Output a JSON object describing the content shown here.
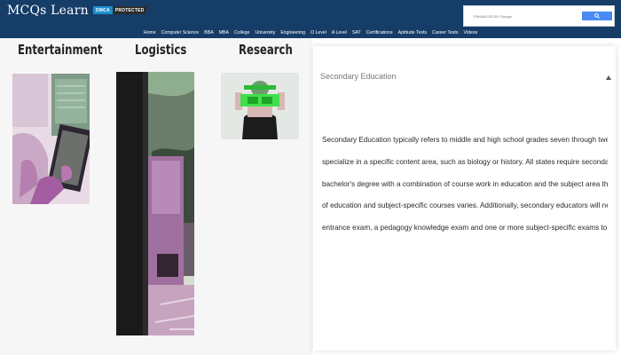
{
  "header": {
    "logo_text": "MCQs Learn",
    "badge_dmca": "DMCA",
    "badge_protected": "PROTECTED",
    "search_placeholder": "ENHANCED BY Google",
    "search_button_icon": "search-icon"
  },
  "nav": {
    "items": [
      "Home",
      "Computer Science",
      "BBA",
      "MBA",
      "College",
      "University",
      "Engineering",
      "O Level",
      "A Level",
      "SAT",
      "Certifications",
      "Aptitude Tests",
      "Career Tests",
      "Videos"
    ]
  },
  "categories": [
    {
      "title": "Entertainment"
    },
    {
      "title": "Logistics"
    },
    {
      "title": "Research"
    }
  ],
  "panel": {
    "title": "Secondary Education",
    "lines": [
      "Secondary Education typically refers to middle and high school grades seven through twelve. Secondary educators usually",
      "specialize in a specific content area, such as biology or history. All states require secondary-level educators to earn a",
      "bachelor's degree with a combination of course work in education and the subject area they will teach, though the number",
      "of education and subject-specific courses varies. Additionally, secondary educators will need to pass an education program",
      "entrance exam, a pedagogy knowledge exam and one or more subject-specific exams to be considered for licensure."
    ]
  },
  "colors": {
    "topbar": "#163d68",
    "dmca_badge": "#1e8fd0",
    "search_button": "#4a8af4",
    "left_background": "#f6f6f6"
  }
}
